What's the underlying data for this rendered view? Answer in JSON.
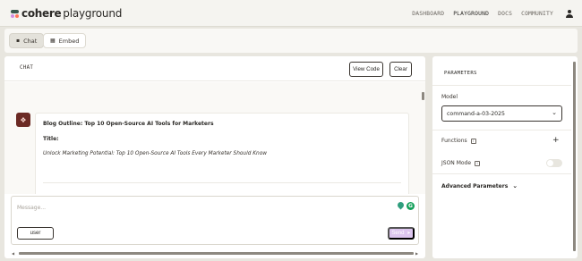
{
  "header": {
    "logo_word": "cohere",
    "logo_suffix": "playground",
    "nav": [
      "DASHBOARD",
      "PLAYGROUND",
      "DOCS",
      "COMMUNITY"
    ],
    "active_nav": "PLAYGROUND"
  },
  "modes": [
    {
      "label": "Chat",
      "icon": "chat-icon",
      "active": true
    },
    {
      "label": "Embed",
      "icon": "embed-icon",
      "active": false
    }
  ],
  "chat": {
    "title": "CHAT",
    "view_code_label": "View Code",
    "clear_label": "Clear",
    "message": {
      "avatar_icon": "cohere-bot-icon",
      "heading": "Blog Outline: Top 10 Open-Source AI Tools for Marketers",
      "title_label": "Title:",
      "line": "Unlock Marketing Potential: Top 10 Open-Source AI Tools Every Marketer Should Know"
    },
    "composer": {
      "placeholder": "Message...",
      "role_label": "user",
      "send_label": "Send"
    }
  },
  "parameters": {
    "title": "PARAMETERS",
    "model_label": "Model",
    "model_value": "command-a-03-2025",
    "functions_label": "Functions",
    "json_mode_label": "JSON Mode",
    "json_mode_on": false,
    "advanced_label": "Advanced Parameters"
  },
  "colors": {
    "background": "#e8e6df",
    "avatar": "#6b2a24",
    "send_button": "#ddc6ef",
    "grammarly": "#15a05a"
  }
}
